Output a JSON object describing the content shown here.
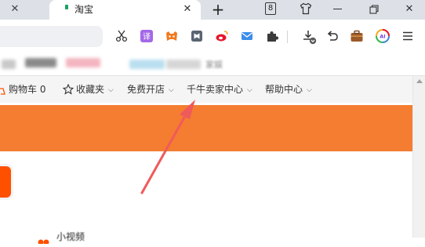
{
  "browser": {
    "tab": {
      "title": "淘宝"
    },
    "tab_count": "8",
    "icons": [
      "close-icon",
      "new-tab-icon",
      "tab-count-icon",
      "shirt-icon",
      "minimize-icon",
      "restore-icon",
      "window-close-icon",
      "scissors-icon",
      "translate-icon",
      "game-icon",
      "reader-icon",
      "weibo-icon",
      "mail-icon",
      "extensions-icon",
      "download-icon",
      "undo-icon",
      "briefcase-icon",
      "ai-icon",
      "menu-icon"
    ],
    "translate_label": "译",
    "ai_label": "AI"
  },
  "bookmarks": {
    "visible_text": "家娱"
  },
  "site_nav": {
    "items": [
      {
        "label": "购物车 0",
        "has_chevron": false
      },
      {
        "label": "收藏夹",
        "has_chevron": true
      },
      {
        "label": "免费开店",
        "has_chevron": true
      },
      {
        "label": "千牛卖家中心",
        "has_chevron": true
      },
      {
        "label": "帮助中心",
        "has_chevron": true
      }
    ],
    "chevron": "⌵"
  },
  "page": {
    "bottom_text": "小视频"
  },
  "colors": {
    "banner": "#f47d31",
    "accent": "#ff5000",
    "annotation_arrow": "#f05a5a",
    "tab_strip": "#dde1e7",
    "nav_bar": "#f5f5f5"
  }
}
